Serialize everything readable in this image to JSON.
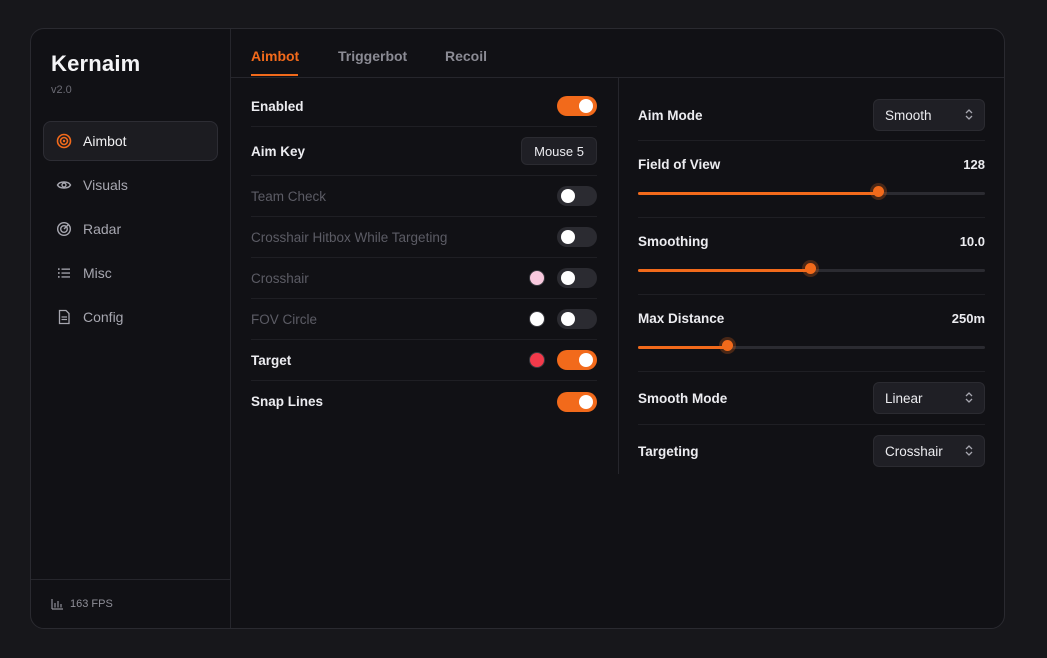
{
  "app": {
    "name": "Kernaim",
    "version": "v2.0"
  },
  "sidebar": {
    "items": [
      {
        "label": "Aimbot",
        "icon": "target-icon",
        "active": true
      },
      {
        "label": "Visuals",
        "icon": "eye-icon"
      },
      {
        "label": "Radar",
        "icon": "radar-icon"
      },
      {
        "label": "Misc",
        "icon": "list-icon"
      },
      {
        "label": "Config",
        "icon": "file-icon"
      }
    ],
    "fps": "163 FPS"
  },
  "tabs": [
    {
      "label": "Aimbot",
      "active": true
    },
    {
      "label": "Triggerbot"
    },
    {
      "label": "Recoil"
    }
  ],
  "left": {
    "enabled": {
      "label": "Enabled",
      "on": true
    },
    "aim_key": {
      "label": "Aim Key",
      "value": "Mouse 5"
    },
    "team_check": {
      "label": "Team Check",
      "on": false
    },
    "hitbox": {
      "label": "Crosshair Hitbox While Targeting",
      "on": false
    },
    "crosshair": {
      "label": "Crosshair",
      "on": false,
      "color": "#f8c9de"
    },
    "fov_circle": {
      "label": "FOV Circle",
      "on": false,
      "color": "#ffffff"
    },
    "target": {
      "label": "Target",
      "on": true,
      "color": "#f23a4b"
    },
    "snap_lines": {
      "label": "Snap Lines",
      "on": true
    }
  },
  "right": {
    "aim_mode": {
      "label": "Aim Mode",
      "value": "Smooth"
    },
    "fov": {
      "label": "Field of View",
      "value": "128",
      "fraction": 0.695
    },
    "smoothing": {
      "label": "Smoothing",
      "value": "10.0",
      "fraction": 0.498
    },
    "max_distance": {
      "label": "Max Distance",
      "value": "250m",
      "fraction": 0.258
    },
    "smooth_mode": {
      "label": "Smooth Mode",
      "value": "Linear"
    },
    "targeting": {
      "label": "Targeting",
      "value": "Crosshair"
    }
  },
  "colors": {
    "accent": "#f26a1b",
    "bg": "#111115",
    "toggle_off": "#2b2b31"
  }
}
